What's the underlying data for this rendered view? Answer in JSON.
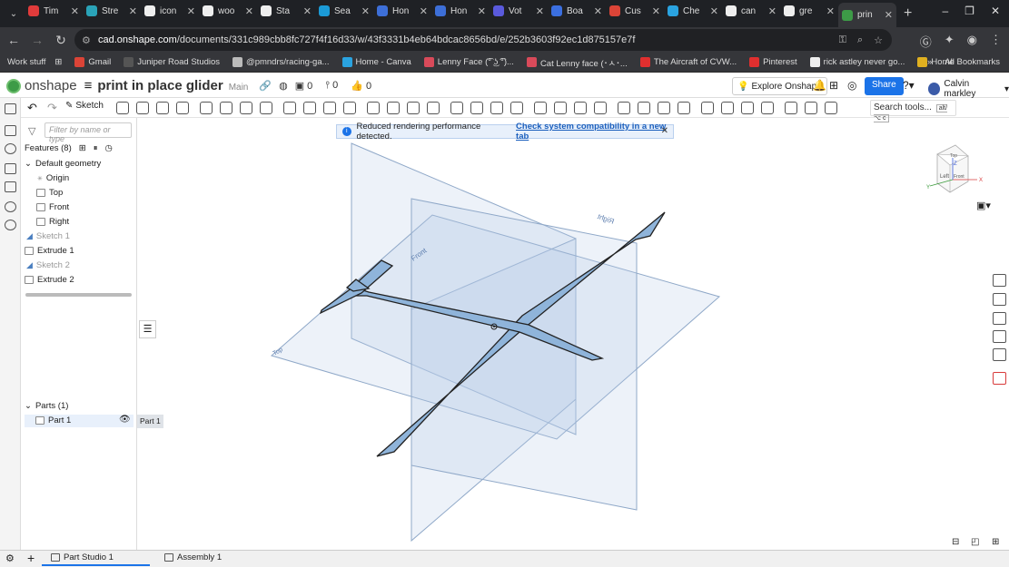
{
  "browser": {
    "tabs": [
      {
        "title": "Tim",
        "color": "#e03b3b"
      },
      {
        "title": "Stre",
        "color": "#2aa3b8"
      },
      {
        "title": "icon",
        "color": "#eeeeee"
      },
      {
        "title": "woo",
        "color": "#eeeeee"
      },
      {
        "title": "Sta",
        "color": "#eeeeee"
      },
      {
        "title": "Sea",
        "color": "#1b9ad6"
      },
      {
        "title": "Hon",
        "color": "#3d6fd8"
      },
      {
        "title": "Hon",
        "color": "#3d6fd8"
      },
      {
        "title": "Vot",
        "color": "#5a5adc"
      },
      {
        "title": "Boa",
        "color": "#3b6fe0"
      },
      {
        "title": "Cus",
        "color": "#db4437"
      },
      {
        "title": "Che",
        "color": "#2aa3e0"
      },
      {
        "title": "can",
        "color": "#eeeeee"
      },
      {
        "title": "gre",
        "color": "#eeeeee"
      },
      {
        "title": "prin",
        "color": "#3d9b47"
      }
    ],
    "url_site": "cad.onshape.com",
    "url_path": "/documents/331c989cbb8fc727f4f16d33/w/43f3331b4eb64bdcac8656bd/e/252b3603f92ec1d875157e7f",
    "bookmarks": [
      {
        "label": "Work stuff",
        "color": ""
      },
      {
        "label": "Gmail",
        "color": "#db4437"
      },
      {
        "label": "Juniper Road Studios",
        "color": "#555555"
      },
      {
        "label": "@pmndrs/racing-ga...",
        "color": "#bbbbbb"
      },
      {
        "label": "Home - Canva",
        "color": "#2aa3e0"
      },
      {
        "label": "Lenny Face (͡° ͜ʖ ͡°)...",
        "color": "#d94a5a"
      },
      {
        "label": "Cat Lenny face (･ㅅ･...",
        "color": "#d94a5a"
      },
      {
        "label": "The Aircraft of CVW...",
        "color": "#e02f2f"
      },
      {
        "label": "Pinterest",
        "color": "#e02f2f"
      },
      {
        "label": "rick astley never go...",
        "color": "#eeeeee"
      },
      {
        "label": "Home",
        "color": "#e0b020"
      }
    ],
    "all_bookmarks": "All Bookmarks"
  },
  "onshape": {
    "logo": "onshape",
    "doc_title": "print in place glider",
    "branch": "Main",
    "counts": {
      "versions": "0",
      "dependents": "0",
      "likes": "0"
    },
    "explore": "Explore Onshape",
    "share": "Share",
    "user": "Calvin markley",
    "sketch": "Sketch",
    "search_tools": "Search tools...",
    "search_shortcut": "alt/⌥ c"
  },
  "banner": {
    "text": "Reduced rendering performance detected.",
    "link": "Check system compatibility in a new tab"
  },
  "features": {
    "filter_placeholder": "Filter by name or type",
    "header": "Features (8)",
    "default_geometry": "Default geometry",
    "items": [
      "Origin",
      "Top",
      "Front",
      "Right",
      "Sketch 1",
      "Extrude 1",
      "Sketch 2",
      "Extrude 2"
    ],
    "parts_header": "Parts (1)",
    "part": "Part 1",
    "part_tip": "Part 1"
  },
  "viewport": {
    "plane_labels": [
      "Front",
      "Right",
      "Top"
    ],
    "viewcube": {
      "top": "Top",
      "left": "Left",
      "front": "Front",
      "z": "Z",
      "x": "X",
      "y": "Y"
    },
    "plane_color": "#b8cde6",
    "part_color": "#8fb4da"
  },
  "bottom": {
    "tabs": [
      "Part Studio 1",
      "Assembly 1"
    ]
  }
}
